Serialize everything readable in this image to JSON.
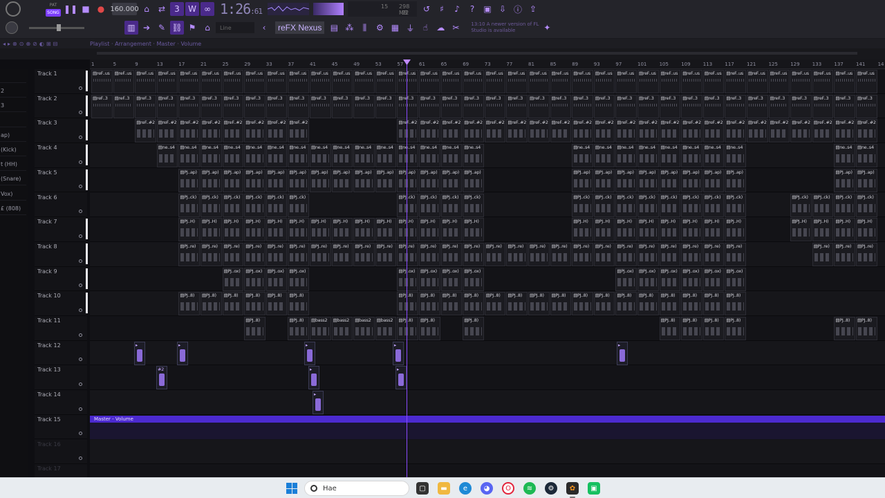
{
  "toolbar": {
    "pat_label": "PAT",
    "song_label": "SONG",
    "tempo": "160.000",
    "time_main": "1:26",
    "time_sub": ":61",
    "cpu_value": "15",
    "memory_value": "298 MB",
    "polyphony_value": "22",
    "snap_mode": "Line",
    "plugin_name": "reFX Nexus",
    "news_text": "13:10 A newer version of FL Studio is available"
  },
  "playlist": {
    "title": "Playlist · Arrangement · Master · Volume",
    "ruler_ticks": [
      "1",
      "5",
      "9",
      "13",
      "17",
      "21",
      "25",
      "29",
      "33",
      "37",
      "41",
      "45",
      "49",
      "53",
      "57",
      "61",
      "65",
      "69",
      "73",
      "77",
      "81",
      "85",
      "89",
      "93",
      "97",
      "101",
      "105",
      "109",
      "113",
      "117",
      "121",
      "125",
      "129",
      "133",
      "137",
      "141",
      "14"
    ],
    "master_clip_label": "Master - Volume",
    "tracks": [
      "Track 1",
      "Track 2",
      "Track 3",
      "Track 4",
      "Track 5",
      "Track 6",
      "Track 7",
      "Track 8",
      "Track 9",
      "Track 10",
      "Track 11",
      "Track 12",
      "Track 13",
      "Track 14",
      "Track 15",
      "Track 16",
      "Track 17"
    ]
  },
  "browser": {
    "items": [
      "",
      "2",
      "3",
      "",
      "ap)",
      "(Kick)",
      "t (HH)",
      "(Snare)",
      "Vox)",
      "£ (808)"
    ]
  },
  "clips": {
    "t1": "reF..us",
    "t2": "reF..3",
    "t3": "reF..#2",
    "t4": "ne..s4",
    "t5": "PJ..ap)",
    "t6": "PJ..ck)",
    "t7": "PJ..H)",
    "t8": "PJ..re)",
    "t9": "PJ..ox)",
    "t10": "PJ..8)",
    "t11": "PJ..8)",
    "bass": "bass2",
    "t12": "▸",
    "t13": "#2"
  },
  "taskbar": {
    "search_text": "Hae",
    "apps": [
      "file-explorer",
      "folder",
      "edge",
      "discord",
      "opera",
      "spotify",
      "steam",
      "fl-studio",
      "app-green"
    ]
  },
  "colors": {
    "accent": "#7b3cff",
    "master_clip": "#4c2ad0",
    "playhead": "#8a4aff"
  }
}
